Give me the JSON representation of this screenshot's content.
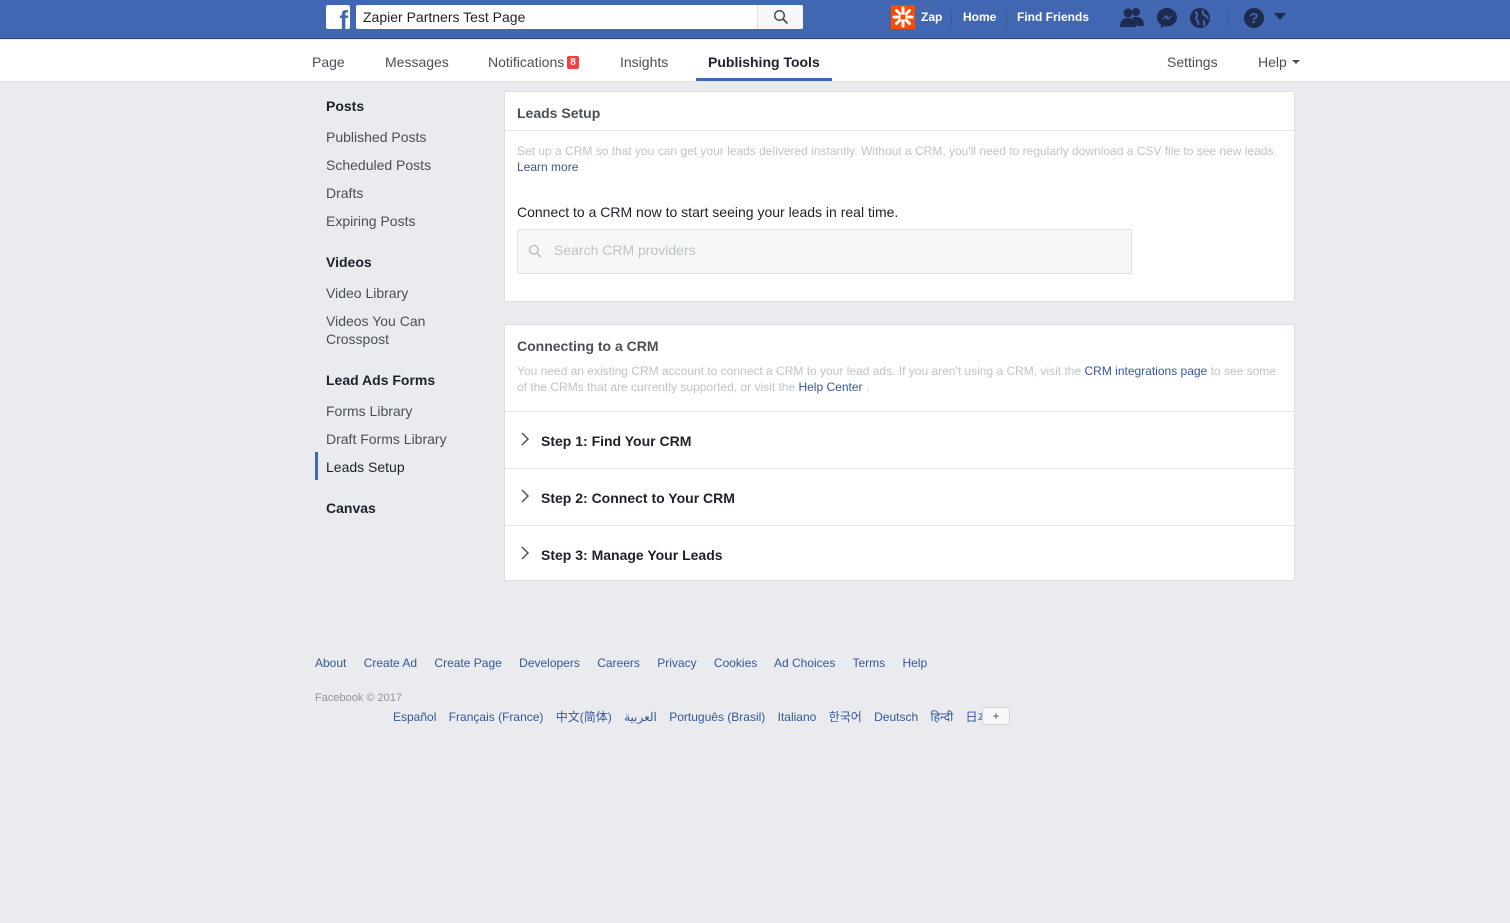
{
  "topbar": {
    "search_value": "Zapier Partners Test Page",
    "profile_name": "Zap",
    "home_label": "Home",
    "find_friends_label": "Find Friends"
  },
  "tabs": {
    "page": "Page",
    "messages": "Messages",
    "notifications": "Notifications",
    "notifications_count": "8",
    "insights": "Insights",
    "publishing_tools": "Publishing Tools",
    "settings": "Settings",
    "help": "Help"
  },
  "sidebar": {
    "posts_heading": "Posts",
    "posts_items": [
      "Published Posts",
      "Scheduled Posts",
      "Drafts",
      "Expiring Posts"
    ],
    "videos_heading": "Videos",
    "videos_items": [
      "Video Library",
      "Videos You Can Crosspost"
    ],
    "lead_ads_heading": "Lead Ads Forms",
    "lead_ads_items": [
      "Forms Library",
      "Draft Forms Library",
      "Leads Setup"
    ],
    "canvas_heading": "Canvas"
  },
  "leads_setup": {
    "title": "Leads Setup",
    "description": "Set up a CRM so that you can get your leads delivered instantly. Without a CRM, you'll need to regularly download a CSV file to see new leads.",
    "learn_more": "Learn more",
    "connect_prompt": "Connect to a CRM now to start seeing your leads in real time.",
    "search_placeholder": "Search CRM providers"
  },
  "connecting": {
    "title": "Connecting to a CRM",
    "desc_part1": "You need an existing CRM account to connect a CRM to your lead ads. If you aren't using a CRM, visit the",
    "crm_link": "CRM integrations page",
    "desc_part2": "to see some of the CRMs that are currently supported, or visit the",
    "help_center_link": "Help Center",
    "desc_part3": ".",
    "steps": [
      "Step 1: Find Your CRM",
      "Step 2: Connect to Your CRM",
      "Step 3: Manage Your Leads"
    ]
  },
  "footer": {
    "links": [
      "About",
      "Create Ad",
      "Create Page",
      "Developers",
      "Careers",
      "Privacy",
      "Cookies",
      "Ad Choices",
      "Terms",
      "Help"
    ],
    "copyright": "Facebook © 2017",
    "languages": [
      "Español",
      "Français (France)",
      "中文(简体)",
      "العربية",
      "Português (Brasil)",
      "Italiano",
      "한국어",
      "Deutsch",
      "हिन्दी",
      "日本語"
    ],
    "more_languages": "+"
  },
  "colors": {
    "brand_blue": "#4267b2",
    "link_blue": "#365899",
    "page_bg": "#e9ebee",
    "badge_red": "#fa3e3e"
  }
}
